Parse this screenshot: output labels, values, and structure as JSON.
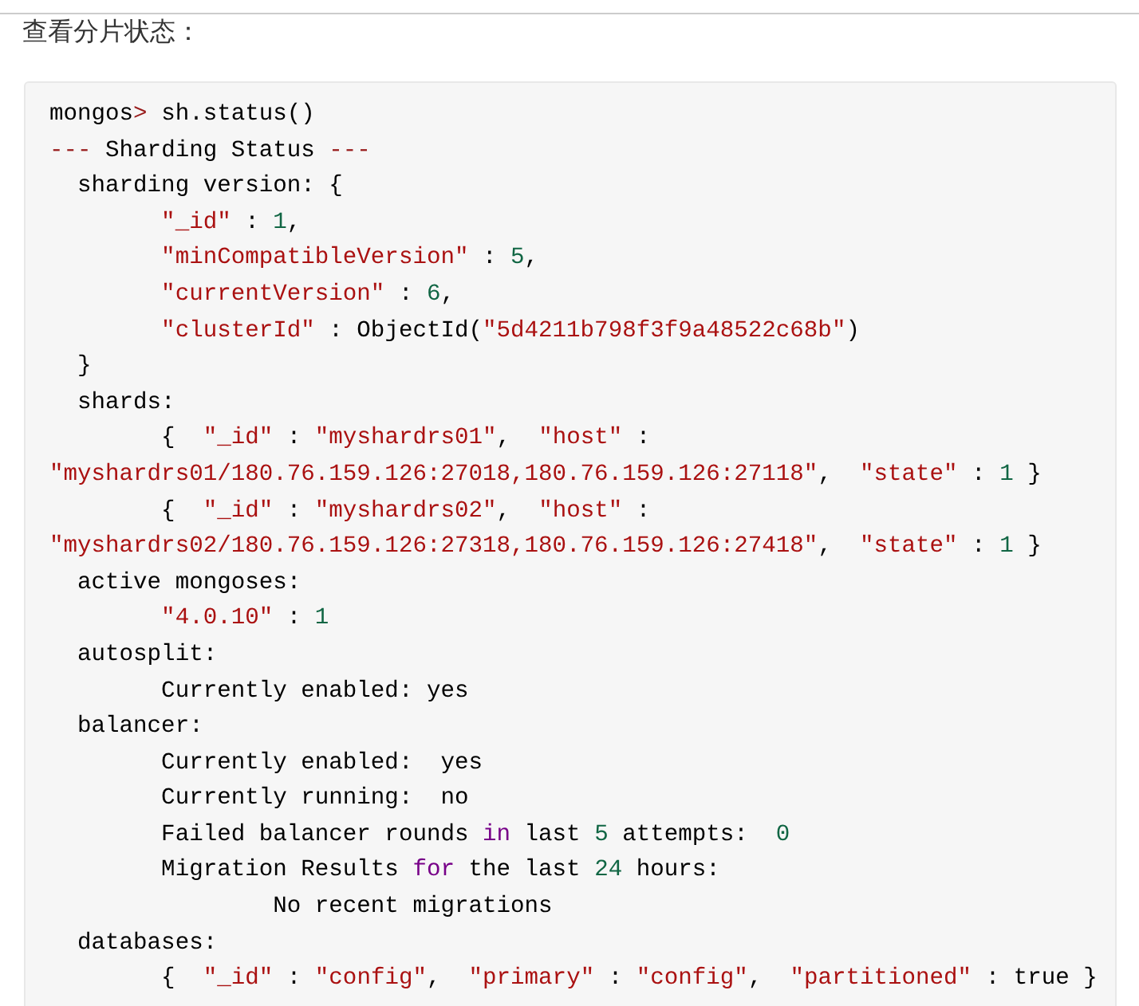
{
  "heading": "查看分片状态：",
  "code_lines": [
    [
      {
        "kind": "plain",
        "text": "mongos"
      },
      {
        "kind": "operator",
        "text": ">"
      },
      {
        "kind": "plain",
        "text": " sh.status()"
      }
    ],
    [
      {
        "kind": "operator",
        "text": "---"
      },
      {
        "kind": "plain",
        "text": " Sharding Status "
      },
      {
        "kind": "operator",
        "text": "---"
      }
    ],
    [
      {
        "kind": "plain",
        "text": "  sharding version: {"
      }
    ],
    [
      {
        "kind": "string",
        "text": "        \"_id\""
      },
      {
        "kind": "plain",
        "text": " : "
      },
      {
        "kind": "number",
        "text": "1"
      },
      {
        "kind": "plain",
        "text": ","
      }
    ],
    [
      {
        "kind": "string",
        "text": "        \"minCompatibleVersion\""
      },
      {
        "kind": "plain",
        "text": " : "
      },
      {
        "kind": "number",
        "text": "5"
      },
      {
        "kind": "plain",
        "text": ","
      }
    ],
    [
      {
        "kind": "string",
        "text": "        \"currentVersion\""
      },
      {
        "kind": "plain",
        "text": " : "
      },
      {
        "kind": "number",
        "text": "6"
      },
      {
        "kind": "plain",
        "text": ","
      }
    ],
    [
      {
        "kind": "string",
        "text": "        \"clusterId\""
      },
      {
        "kind": "plain",
        "text": " : ObjectId("
      },
      {
        "kind": "string",
        "text": "\"5d4211b798f3f9a48522c68b\""
      },
      {
        "kind": "plain",
        "text": ")"
      }
    ],
    [
      {
        "kind": "plain",
        "text": "  }"
      }
    ],
    [
      {
        "kind": "plain",
        "text": "  shards:"
      }
    ],
    [
      {
        "kind": "plain",
        "text": "        {  "
      },
      {
        "kind": "string",
        "text": "\"_id\""
      },
      {
        "kind": "plain",
        "text": " : "
      },
      {
        "kind": "string",
        "text": "\"myshardrs01\""
      },
      {
        "kind": "plain",
        "text": ",  "
      },
      {
        "kind": "string",
        "text": "\"host\""
      },
      {
        "kind": "plain",
        "text": " :"
      }
    ],
    [
      {
        "kind": "string",
        "text": "\"myshardrs01/180.76.159.126:27018,180.76.159.126:27118\""
      },
      {
        "kind": "plain",
        "text": ",  "
      },
      {
        "kind": "string",
        "text": "\"state\""
      },
      {
        "kind": "plain",
        "text": " : "
      },
      {
        "kind": "number",
        "text": "1"
      },
      {
        "kind": "plain",
        "text": " }"
      }
    ],
    [
      {
        "kind": "plain",
        "text": "        {  "
      },
      {
        "kind": "string",
        "text": "\"_id\""
      },
      {
        "kind": "plain",
        "text": " : "
      },
      {
        "kind": "string",
        "text": "\"myshardrs02\""
      },
      {
        "kind": "plain",
        "text": ",  "
      },
      {
        "kind": "string",
        "text": "\"host\""
      },
      {
        "kind": "plain",
        "text": " :"
      }
    ],
    [
      {
        "kind": "string",
        "text": "\"myshardrs02/180.76.159.126:27318,180.76.159.126:27418\""
      },
      {
        "kind": "plain",
        "text": ",  "
      },
      {
        "kind": "string",
        "text": "\"state\""
      },
      {
        "kind": "plain",
        "text": " : "
      },
      {
        "kind": "number",
        "text": "1"
      },
      {
        "kind": "plain",
        "text": " }"
      }
    ],
    [
      {
        "kind": "plain",
        "text": "  active mongoses:"
      }
    ],
    [
      {
        "kind": "string",
        "text": "        \"4.0.10\""
      },
      {
        "kind": "plain",
        "text": " : "
      },
      {
        "kind": "number",
        "text": "1"
      }
    ],
    [
      {
        "kind": "plain",
        "text": "  autosplit:"
      }
    ],
    [
      {
        "kind": "plain",
        "text": "        Currently enabled: yes"
      }
    ],
    [
      {
        "kind": "plain",
        "text": "  balancer:"
      }
    ],
    [
      {
        "kind": "plain",
        "text": "        Currently enabled:  yes"
      }
    ],
    [
      {
        "kind": "plain",
        "text": "        Currently running:  no"
      }
    ],
    [
      {
        "kind": "plain",
        "text": "        Failed balancer rounds "
      },
      {
        "kind": "keyword",
        "text": "in"
      },
      {
        "kind": "plain",
        "text": " last "
      },
      {
        "kind": "number",
        "text": "5"
      },
      {
        "kind": "plain",
        "text": " attempts:  "
      },
      {
        "kind": "number",
        "text": "0"
      }
    ],
    [
      {
        "kind": "plain",
        "text": "        Migration Results "
      },
      {
        "kind": "keyword",
        "text": "for"
      },
      {
        "kind": "plain",
        "text": " the last "
      },
      {
        "kind": "number",
        "text": "24"
      },
      {
        "kind": "plain",
        "text": " hours:"
      }
    ],
    [
      {
        "kind": "plain",
        "text": "                No recent migrations"
      }
    ],
    [
      {
        "kind": "plain",
        "text": "  databases:"
      }
    ],
    [
      {
        "kind": "plain",
        "text": "        {  "
      },
      {
        "kind": "string",
        "text": "\"_id\""
      },
      {
        "kind": "plain",
        "text": " : "
      },
      {
        "kind": "string",
        "text": "\"config\""
      },
      {
        "kind": "plain",
        "text": ",  "
      },
      {
        "kind": "string",
        "text": "\"primary\""
      },
      {
        "kind": "plain",
        "text": " : "
      },
      {
        "kind": "string",
        "text": "\"config\""
      },
      {
        "kind": "plain",
        "text": ",  "
      },
      {
        "kind": "string",
        "text": "\"partitioned\""
      },
      {
        "kind": "plain",
        "text": " : true }"
      }
    ]
  ]
}
